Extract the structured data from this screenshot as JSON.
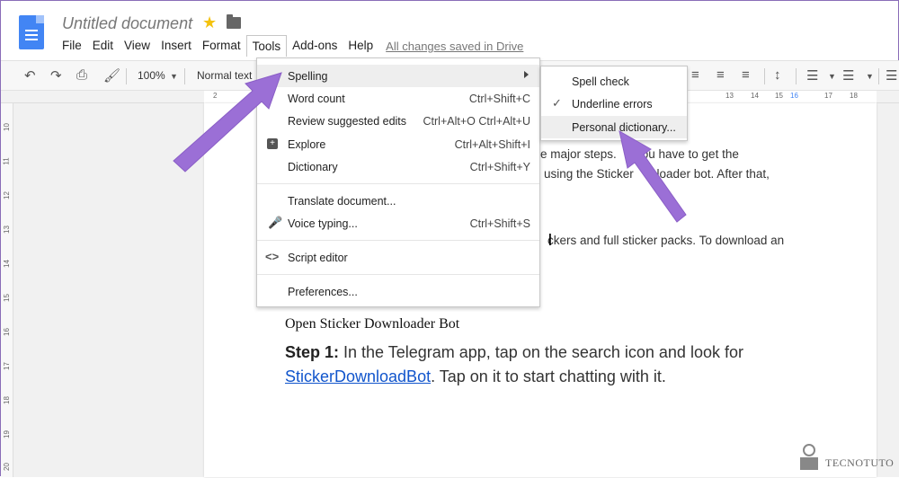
{
  "app": {
    "title": "Untitled document",
    "saved_status": "All changes saved in Drive"
  },
  "menubar": [
    "File",
    "Edit",
    "View",
    "Insert",
    "Format",
    "Tools",
    "Add-ons",
    "Help"
  ],
  "toolbar": {
    "zoom": "100%",
    "style": "Normal text"
  },
  "ruler": {
    "top": [
      "2",
      "13",
      "14",
      "15",
      "16",
      "17",
      "18"
    ],
    "left": [
      "10",
      "11",
      "12",
      "13",
      "14",
      "15",
      "16",
      "17",
      "18",
      "19",
      "20"
    ]
  },
  "document": {
    "line1a": "e major steps.",
    "line1b": "you have to get the",
    "line2a": "using the Sticker",
    "line2b": "nloader bot. After that,",
    "line3": "ckers and full sticker packs. To download an",
    "heading": "Open Sticker Downloader Bot",
    "step_label": "Step 1:",
    "step_text1": " In the Telegram app, tap on the search icon and look for",
    "step_link": "StickerDownloadBot",
    "step_text2": ". Tap on it to start chatting with it."
  },
  "tools_menu": {
    "spelling": "Spelling",
    "word_count": "Word count",
    "word_count_sc": "Ctrl+Shift+C",
    "review": "Review suggested edits",
    "review_sc": "Ctrl+Alt+O Ctrl+Alt+U",
    "explore": "Explore",
    "explore_sc": "Ctrl+Alt+Shift+I",
    "dictionary": "Dictionary",
    "dictionary_sc": "Ctrl+Shift+Y",
    "translate": "Translate document...",
    "voice": "Voice typing...",
    "voice_sc": "Ctrl+Shift+S",
    "script": "Script editor",
    "prefs": "Preferences..."
  },
  "spelling_menu": {
    "spell_check": "Spell check",
    "underline": "Underline errors",
    "personal": "Personal dictionary..."
  },
  "watermark": "TECNOTUTO",
  "colors": {
    "accent": "#4285f4",
    "arrow": "#9b6fd6",
    "link": "#1155cc"
  }
}
